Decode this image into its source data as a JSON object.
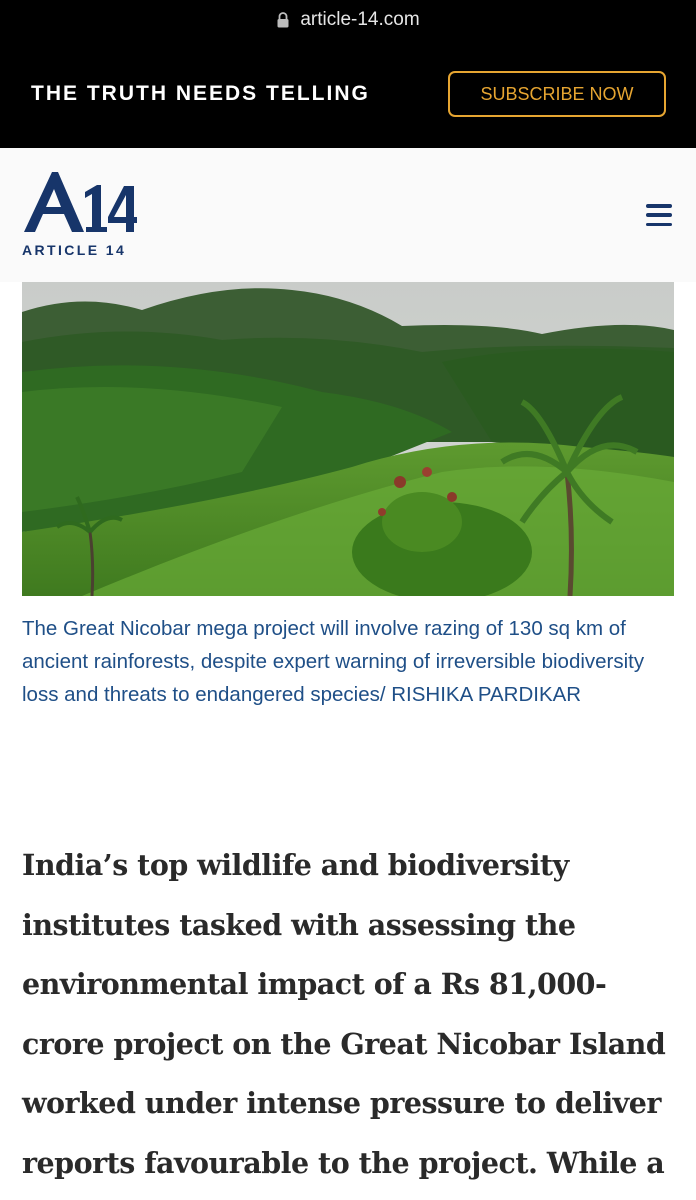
{
  "browser": {
    "url": "article-14.com"
  },
  "promo_bar": {
    "tagline": "THE TRUTH NEEDS TELLING",
    "subscribe_label": "SUBSCRIBE NOW"
  },
  "header": {
    "logo_mark": "A14",
    "logo_wordmark": "ARTICLE 14",
    "menu_icon": "hamburger-menu-icon"
  },
  "figure": {
    "caption": "The Great Nicobar mega project will involve razing of 130 sq km of ancient rainforests, despite expert warning of irreversible biodiversity loss and threats to endangered species/ RISHIKA PARDIKAR"
  },
  "article": {
    "lines": [
      "India’s top wildlife and biodiversity",
      "institutes tasked with assessing the",
      "environmental impact of a Rs 81,000-",
      "crore project on the Great Nicobar Island",
      "worked under intense pressure to deliver",
      "reports favourable to the project. While a"
    ]
  },
  "colors": {
    "brand_navy": "#17356a",
    "accent_gold": "#e6a531",
    "caption_blue": "#1f4f87",
    "body_text": "#2a2a2a"
  }
}
